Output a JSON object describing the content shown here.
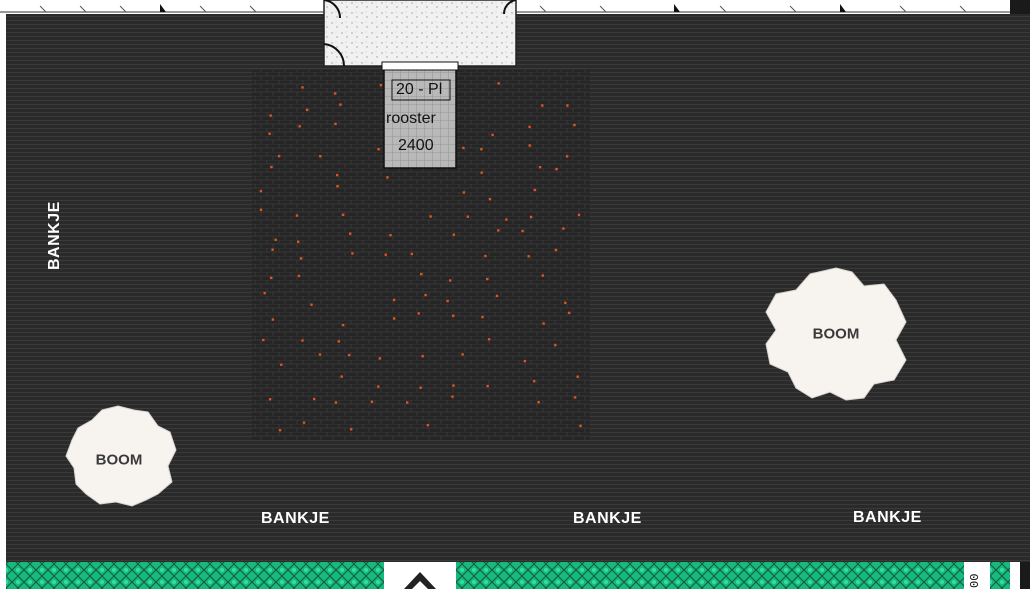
{
  "labels": {
    "bench_left": "BANKJE",
    "bench_bottom_1": "BANKJE",
    "bench_bottom_2": "BANKJE",
    "bench_bottom_3": "BANKJE",
    "tree_right": "BOOM",
    "tree_left": "BOOM"
  },
  "grate": {
    "line1": "20 - Pl",
    "line2": "rooster",
    "line3": "2400"
  },
  "bottom_code": "00",
  "colors": {
    "ground": "#2b2b2b",
    "ground_line": "#3a3a3a",
    "hedge": "#21c98f",
    "paving_dot": "#e0551b",
    "tree": "#f7f4ef",
    "doorway": "#ececec"
  },
  "icons": {
    "arrow": "up-arrow-icon"
  }
}
